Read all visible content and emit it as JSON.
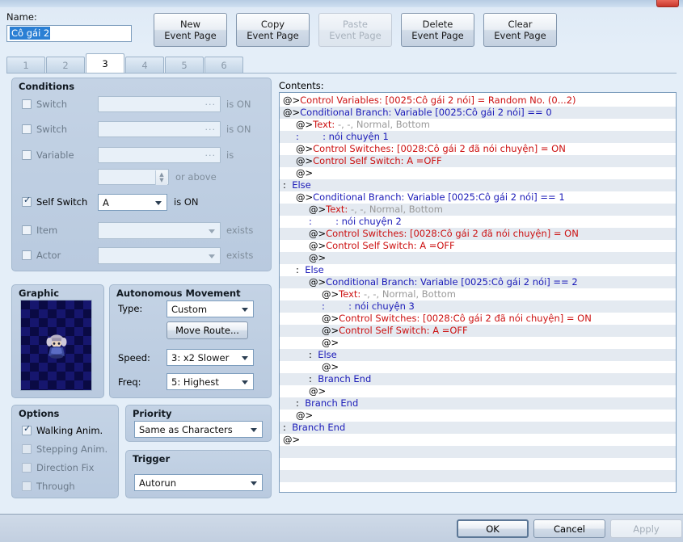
{
  "window": {
    "close_icon": "close-icon"
  },
  "name": {
    "label": "Name:",
    "value": "Cô gái 2"
  },
  "page_buttons": [
    {
      "line1": "New",
      "line2": "Event Page",
      "disabled": false
    },
    {
      "line1": "Copy",
      "line2": "Event Page",
      "disabled": false
    },
    {
      "line1": "Paste",
      "line2": "Event Page",
      "disabled": true
    },
    {
      "line1": "Delete",
      "line2": "Event Page",
      "disabled": false
    },
    {
      "line1": "Clear",
      "line2": "Event Page",
      "disabled": false
    }
  ],
  "tabs": {
    "items": [
      "1",
      "2",
      "3",
      "4",
      "5",
      "6"
    ],
    "active": "3"
  },
  "conditions": {
    "title": "Conditions",
    "rows": [
      {
        "label": "Switch",
        "checked": false,
        "value": "",
        "suffix": "is ON",
        "control": "textfield"
      },
      {
        "label": "Switch",
        "checked": false,
        "value": "",
        "suffix": "is ON",
        "control": "textfield"
      },
      {
        "label": "Variable",
        "checked": false,
        "value": "",
        "suffix": "is",
        "control": "textfield"
      },
      {
        "label": "",
        "checked": null,
        "value": "",
        "suffix": "or above",
        "control": "spinner"
      },
      {
        "label": "Self Switch",
        "checked": true,
        "value": "A",
        "suffix": "is ON",
        "control": "dropdown"
      },
      {
        "label": "Item",
        "checked": false,
        "value": "",
        "suffix": "exists",
        "control": "dropdown"
      },
      {
        "label": "Actor",
        "checked": false,
        "value": "",
        "suffix": "exists",
        "control": "dropdown"
      }
    ]
  },
  "graphic": {
    "title": "Graphic",
    "preview_name": "character-sprite-preview"
  },
  "autonomous_movement": {
    "title": "Autonomous Movement",
    "type_label": "Type:",
    "type_value": "Custom",
    "move_route_button": "Move Route...",
    "speed_label": "Speed:",
    "speed_value": "3: x2 Slower",
    "freq_label": "Freq:",
    "freq_value": "5: Highest"
  },
  "options": {
    "title": "Options",
    "items": [
      {
        "label": "Walking Anim.",
        "checked": true
      },
      {
        "label": "Stepping Anim.",
        "checked": false
      },
      {
        "label": "Direction Fix",
        "checked": false
      },
      {
        "label": "Through",
        "checked": false
      }
    ]
  },
  "priority": {
    "title": "Priority",
    "value": "Same as Characters"
  },
  "trigger": {
    "title": "Trigger",
    "value": "Autorun"
  },
  "contents": {
    "label": "Contents:",
    "lines": [
      {
        "indent": 0,
        "segments": [
          {
            "t": "@>",
            "c": "blk"
          },
          {
            "t": "Control Variables: [0025:Cô gái 2 nói] = Random No. (0...2)",
            "c": "red"
          }
        ]
      },
      {
        "indent": 0,
        "segments": [
          {
            "t": "@>",
            "c": "blk"
          },
          {
            "t": "Conditional Branch: Variable [0025:Cô gái 2 nói] == 0",
            "c": "blue"
          }
        ]
      },
      {
        "indent": 1,
        "segments": [
          {
            "t": "@>",
            "c": "blk"
          },
          {
            "t": "Text: ",
            "c": "red"
          },
          {
            "t": "-, -, Normal, Bottom",
            "c": "gray"
          }
        ]
      },
      {
        "indent": 1,
        "segments": [
          {
            "t": ":        : nói chuyện 1",
            "c": "blue"
          }
        ]
      },
      {
        "indent": 1,
        "segments": [
          {
            "t": "@>",
            "c": "blk"
          },
          {
            "t": "Control Switches: [0028:Cô gái 2 đã nói chuyện] = ON",
            "c": "red"
          }
        ]
      },
      {
        "indent": 1,
        "segments": [
          {
            "t": "@>",
            "c": "blk"
          },
          {
            "t": "Control Self Switch: A =OFF",
            "c": "red"
          }
        ]
      },
      {
        "indent": 1,
        "segments": [
          {
            "t": "@>",
            "c": "blk"
          }
        ]
      },
      {
        "indent": 0,
        "segments": [
          {
            "t": ":  ",
            "c": "blk"
          },
          {
            "t": "Else",
            "c": "blue"
          }
        ]
      },
      {
        "indent": 1,
        "segments": [
          {
            "t": "@>",
            "c": "blk"
          },
          {
            "t": "Conditional Branch: Variable [0025:Cô gái 2 nói] == 1",
            "c": "blue"
          }
        ]
      },
      {
        "indent": 2,
        "segments": [
          {
            "t": "@>",
            "c": "blk"
          },
          {
            "t": "Text: ",
            "c": "red"
          },
          {
            "t": "-, -, Normal, Bottom",
            "c": "gray"
          }
        ]
      },
      {
        "indent": 2,
        "segments": [
          {
            "t": ":        : nói chuyện 2",
            "c": "blue"
          }
        ]
      },
      {
        "indent": 2,
        "segments": [
          {
            "t": "@>",
            "c": "blk"
          },
          {
            "t": "Control Switches: [0028:Cô gái 2 đã nói chuyện] = ON",
            "c": "red"
          }
        ]
      },
      {
        "indent": 2,
        "segments": [
          {
            "t": "@>",
            "c": "blk"
          },
          {
            "t": "Control Self Switch: A =OFF",
            "c": "red"
          }
        ]
      },
      {
        "indent": 2,
        "segments": [
          {
            "t": "@>",
            "c": "blk"
          }
        ]
      },
      {
        "indent": 1,
        "segments": [
          {
            "t": ":  ",
            "c": "blk"
          },
          {
            "t": "Else",
            "c": "blue"
          }
        ]
      },
      {
        "indent": 2,
        "segments": [
          {
            "t": "@>",
            "c": "blk"
          },
          {
            "t": "Conditional Branch: Variable [0025:Cô gái 2 nói] == 2",
            "c": "blue"
          }
        ]
      },
      {
        "indent": 3,
        "segments": [
          {
            "t": "@>",
            "c": "blk"
          },
          {
            "t": "Text: ",
            "c": "red"
          },
          {
            "t": "-, -, Normal, Bottom",
            "c": "gray"
          }
        ]
      },
      {
        "indent": 3,
        "segments": [
          {
            "t": ":        : nói chuyện 3",
            "c": "blue"
          }
        ]
      },
      {
        "indent": 3,
        "segments": [
          {
            "t": "@>",
            "c": "blk"
          },
          {
            "t": "Control Switches: [0028:Cô gái 2 đã nói chuyện] = ON",
            "c": "red"
          }
        ]
      },
      {
        "indent": 3,
        "segments": [
          {
            "t": "@>",
            "c": "blk"
          },
          {
            "t": "Control Self Switch: A =OFF",
            "c": "red"
          }
        ]
      },
      {
        "indent": 3,
        "segments": [
          {
            "t": "@>",
            "c": "blk"
          }
        ]
      },
      {
        "indent": 2,
        "segments": [
          {
            "t": ":  ",
            "c": "blk"
          },
          {
            "t": "Else",
            "c": "blue"
          }
        ]
      },
      {
        "indent": 3,
        "segments": [
          {
            "t": "@>",
            "c": "blk"
          }
        ]
      },
      {
        "indent": 2,
        "segments": [
          {
            "t": ":  ",
            "c": "blk"
          },
          {
            "t": "Branch End",
            "c": "blue"
          }
        ]
      },
      {
        "indent": 2,
        "segments": [
          {
            "t": "@>",
            "c": "blk"
          }
        ]
      },
      {
        "indent": 1,
        "segments": [
          {
            "t": ":  ",
            "c": "blk"
          },
          {
            "t": "Branch End",
            "c": "blue"
          }
        ]
      },
      {
        "indent": 1,
        "segments": [
          {
            "t": "@>",
            "c": "blk"
          }
        ]
      },
      {
        "indent": 0,
        "segments": [
          {
            "t": ":  ",
            "c": "blk"
          },
          {
            "t": "Branch End",
            "c": "blue"
          }
        ]
      },
      {
        "indent": 0,
        "segments": [
          {
            "t": "@>",
            "c": "blk"
          }
        ]
      }
    ]
  },
  "footer": {
    "ok": "OK",
    "cancel": "Cancel",
    "apply": "Apply"
  }
}
